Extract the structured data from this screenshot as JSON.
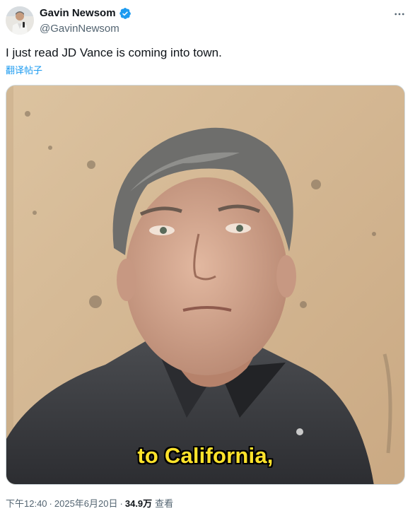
{
  "author": {
    "name": "Gavin Newsom",
    "handle": "@GavinNewsom",
    "verified_color": "#1d9bf0"
  },
  "tweet": {
    "text": "I just read JD Vance is coming into town.",
    "translate_label": "翻译帖子"
  },
  "media": {
    "type": "video",
    "caption": "to California,",
    "caption_color": "#ffe32b"
  },
  "footer": {
    "time": "下午12:40",
    "separator": "·",
    "date": "2025年6月20日",
    "views_count": "34.9万",
    "views_label": "查看"
  },
  "icons": {
    "avatar": "avatar-photo",
    "verified": "verified-badge-icon",
    "more": "more-options-icon"
  }
}
